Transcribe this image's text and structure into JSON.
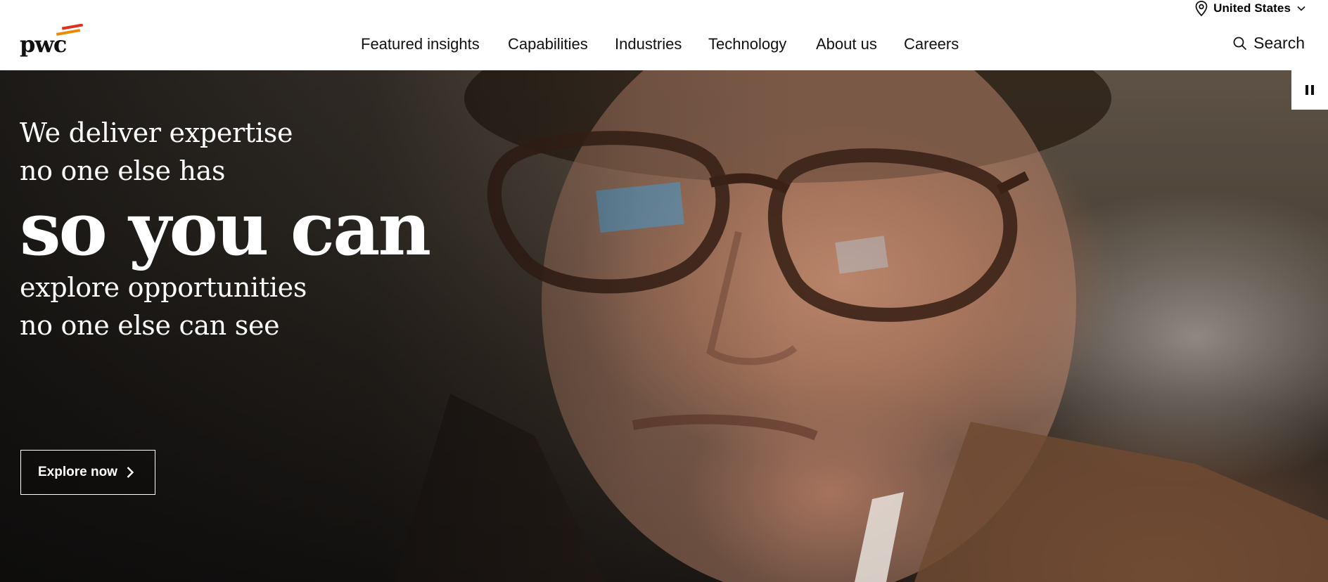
{
  "brand": {
    "logo_text": "pwc",
    "accent_color": "#e0301e",
    "accent_color_2": "#eb8c00"
  },
  "locale": {
    "label": "United States",
    "icon": "location-pin-icon"
  },
  "nav": {
    "items": [
      {
        "label": "Featured insights"
      },
      {
        "label": "Capabilities"
      },
      {
        "label": "Industries"
      },
      {
        "label": "Technology"
      },
      {
        "label": "About us"
      },
      {
        "label": "Careers"
      }
    ],
    "search_label": "Search"
  },
  "hero": {
    "line1": "We deliver expertise",
    "line2": "no one else has",
    "headline": "so you can",
    "line3": "explore opportunities",
    "line4": "no one else can see",
    "cta_label": "Explore now"
  },
  "media_control": {
    "icon": "pause-icon"
  }
}
